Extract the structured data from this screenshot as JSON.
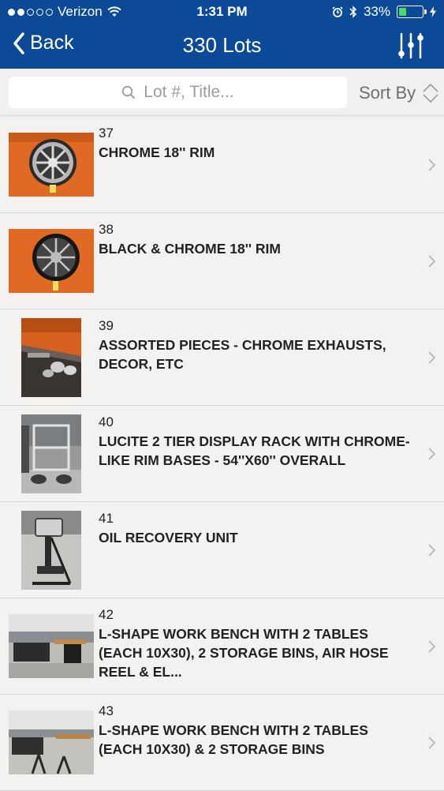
{
  "status": {
    "carrier": "Verizon",
    "time": "1:31 PM",
    "battery": "33%",
    "battery_level": 0.33,
    "accent_green": "#4cd964"
  },
  "nav": {
    "back_label": "Back",
    "title": "330 Lots",
    "bg_color": "#0c4a97"
  },
  "search": {
    "placeholder": "Lot #, Title...",
    "sort_label": "Sort By"
  },
  "lots": [
    {
      "number": "37",
      "title": "CHROME 18'' RIM"
    },
    {
      "number": "38",
      "title": "BLACK & CHROME 18'' RIM"
    },
    {
      "number": "39",
      "title": "ASSORTED PIECES - CHROME EXHAUSTS, DECOR, ETC"
    },
    {
      "number": "40",
      "title": "LUCITE 2 TIER DISPLAY RACK WITH CHROME-LIKE RIM BASES - 54''x60'' OVERALL"
    },
    {
      "number": "41",
      "title": "OIL RECOVERY UNIT"
    },
    {
      "number": "42",
      "title": "L-SHAPE WORK BENCH WITH 2 TABLES (EACH 10x30), 2 STORAGE BINS, AIR HOSE REEL & EL..."
    },
    {
      "number": "43",
      "title": "L-SHAPE WORK BENCH WITH 2 TABLES (EACH 10x30) & 2 STORAGE BINS"
    }
  ]
}
